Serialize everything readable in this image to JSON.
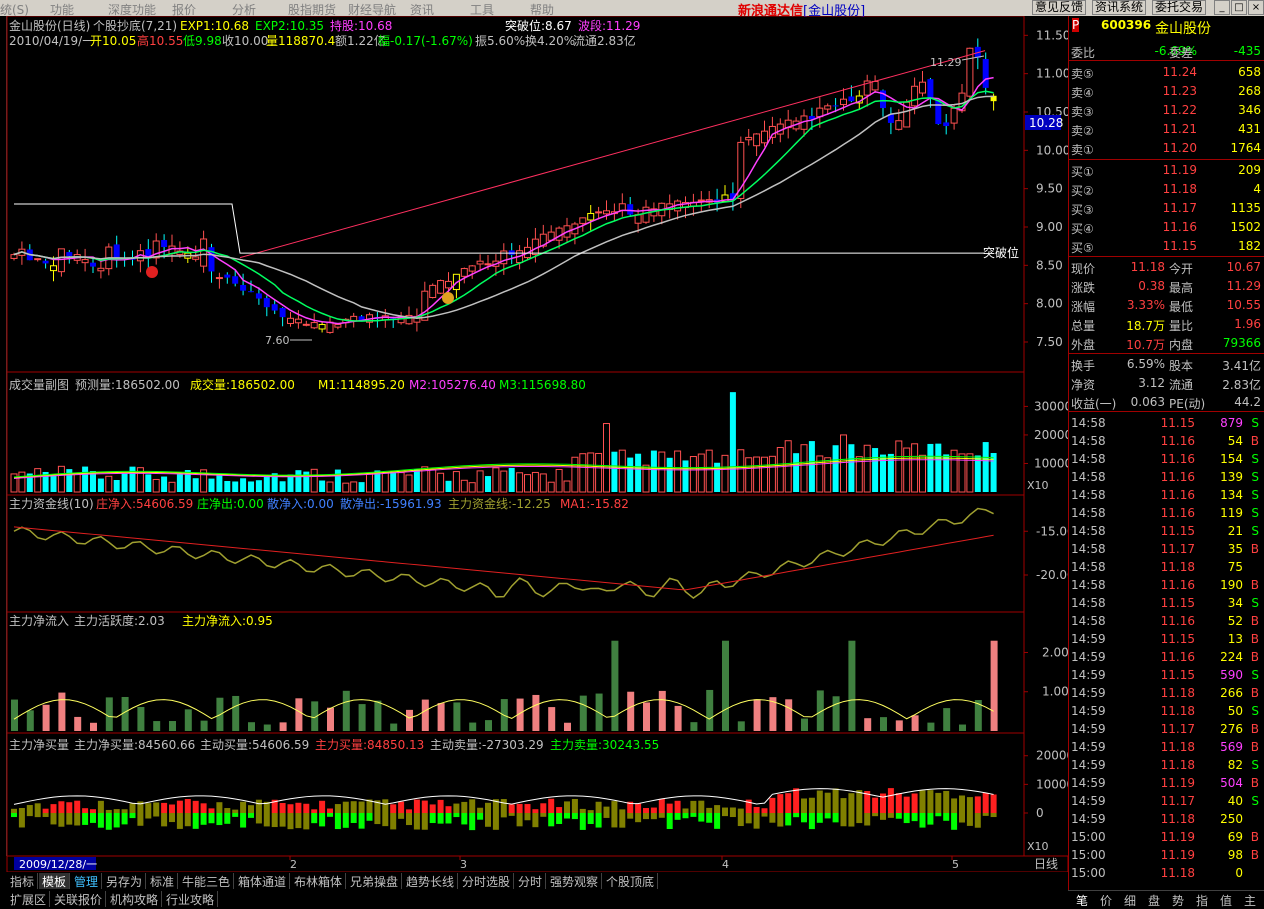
{
  "menu": {
    "items": [
      "统(S)",
      "功能",
      "深度功能",
      "报价",
      "分析",
      "股指期货",
      "财经导航",
      "资讯",
      "工具",
      "帮助"
    ],
    "brand": "新浪通达信",
    "brand_sub": "[金山股份]",
    "buttons": [
      "意见反馈",
      "资讯系统",
      "委托交易"
    ]
  },
  "stock": {
    "code": "600396",
    "name": "金山股份",
    "badge": "P"
  },
  "main_panel": {
    "title": "金山股份(日线)",
    "formula": "个股抄底(7,21)",
    "exp1": "EXP1:10.68",
    "exp2": "EXP2:10.35",
    "hold": "持股:10.68",
    "breakout": "突破位:8.67",
    "wave": "波段:11.29",
    "line2": "2010/04/19/一",
    "open": "开10.05",
    "high": "高10.55",
    "low": "低9.98",
    "close": "收10.00",
    "vol": "量118870.4",
    "amt": "额1.22亿",
    "chg": "幅-0.17(-1.67%)",
    "amp": "振5.60%",
    "turn": "换4.20%",
    "circ": "流通2.83亿",
    "hi_label": "11.29",
    "lo_label": "7.60",
    "breakout_label": "突破位",
    "price_tag": "10.28",
    "yticks": [
      "11.50",
      "11.00",
      "10.50",
      "10.00",
      "9.50",
      "9.00",
      "8.50",
      "8.00",
      "7.50"
    ]
  },
  "vol_panel": {
    "title": "成交量副图",
    "pred": "预测量:186502.00",
    "vol": "成交量:186502.00",
    "m1": "M1:114895.20",
    "m2": "M2:105276.40",
    "m3": "M3:115698.80",
    "yticks": [
      "30000",
      "20000",
      "10000"
    ],
    "unit": "X10"
  },
  "fund_panel": {
    "title": "主力资金线(10)",
    "a": "庄净入:54606.59",
    "b": "庄净出:0.00",
    "c": "散净入:0.00",
    "d": "散净出:-15961.93",
    "e": "主力资金线:-12.25",
    "f": "MA1:-15.82",
    "yticks": [
      "-15.00",
      "-20.00"
    ]
  },
  "flow_panel": {
    "title": "主力净流入",
    "a": "主力活跃度:2.03",
    "b": "主力净流入:0.95",
    "yticks": [
      "2.00",
      "1.00"
    ]
  },
  "buy_panel": {
    "title": "主力净买量",
    "a": "主力净买量:84560.66",
    "b": "主动买量:54606.59",
    "c": "主力买量:84850.13",
    "d": "主动卖量:-27303.29",
    "e": "主力卖量:30243.55",
    "yticks": [
      "20000",
      "10000",
      "0"
    ],
    "unit": "X10"
  },
  "xaxis": {
    "date": "2009/12/28/一",
    "months": [
      "2",
      "3",
      "4",
      "5"
    ],
    "period": "日线"
  },
  "order_book": {
    "weibi_label": "委比",
    "weibi": "-6.69%",
    "weicha_label": "委差",
    "weicha": "-435",
    "asks": [
      {
        "l": "卖⑤",
        "p": "11.24",
        "v": "658"
      },
      {
        "l": "卖④",
        "p": "11.23",
        "v": "268"
      },
      {
        "l": "卖③",
        "p": "11.22",
        "v": "346"
      },
      {
        "l": "卖②",
        "p": "11.21",
        "v": "431"
      },
      {
        "l": "卖①",
        "p": "11.20",
        "v": "1764"
      }
    ],
    "bids": [
      {
        "l": "买①",
        "p": "11.19",
        "v": "209"
      },
      {
        "l": "买②",
        "p": "11.18",
        "v": "4"
      },
      {
        "l": "买③",
        "p": "11.17",
        "v": "1135"
      },
      {
        "l": "买④",
        "p": "11.16",
        "v": "1502"
      },
      {
        "l": "买⑤",
        "p": "11.15",
        "v": "182"
      }
    ]
  },
  "quote": [
    {
      "l1": "现价",
      "v1": "11.18",
      "c1": "#ff4040",
      "l2": "今开",
      "v2": "10.67",
      "c2": "#ff4040"
    },
    {
      "l1": "涨跌",
      "v1": "0.38",
      "c1": "#ff4040",
      "l2": "最高",
      "v2": "11.29",
      "c2": "#ff4040"
    },
    {
      "l1": "涨幅",
      "v1": "3.33%",
      "c1": "#ff4040",
      "l2": "最低",
      "v2": "10.55",
      "c2": "#ff4040"
    },
    {
      "l1": "总量",
      "v1": "18.7万",
      "c1": "#ffff00",
      "l2": "量比",
      "v2": "1.96",
      "c2": "#ff4040"
    },
    {
      "l1": "外盘",
      "v1": "10.7万",
      "c1": "#ff4040",
      "l2": "内盘",
      "v2": "79366",
      "c2": "#00ff00"
    },
    {
      "l1": "换手",
      "v1": "6.59%",
      "c1": "#c0c0c0",
      "l2": "股本",
      "v2": "3.41亿",
      "c2": "#c0c0c0"
    },
    {
      "l1": "净资",
      "v1": "3.12",
      "c1": "#c0c0c0",
      "l2": "流通",
      "v2": "2.83亿",
      "c2": "#c0c0c0"
    },
    {
      "l1": "收益(一)",
      "v1": "0.063",
      "c1": "#c0c0c0",
      "l2": "PE(动)",
      "v2": "44.2",
      "c2": "#c0c0c0"
    }
  ],
  "ticks": [
    {
      "t": "14:58",
      "p": "11.15",
      "v": "879",
      "s": "S"
    },
    {
      "t": "14:58",
      "p": "11.16",
      "v": "54",
      "s": "B"
    },
    {
      "t": "14:58",
      "p": "11.16",
      "v": "154",
      "s": "S"
    },
    {
      "t": "14:58",
      "p": "11.16",
      "v": "139",
      "s": "S"
    },
    {
      "t": "14:58",
      "p": "11.16",
      "v": "134",
      "s": "S"
    },
    {
      "t": "14:58",
      "p": "11.16",
      "v": "119",
      "s": "S"
    },
    {
      "t": "14:58",
      "p": "11.15",
      "v": "21",
      "s": "S"
    },
    {
      "t": "14:58",
      "p": "11.17",
      "v": "35",
      "s": "B"
    },
    {
      "t": "14:58",
      "p": "11.18",
      "v": "75",
      "s": ""
    },
    {
      "t": "14:58",
      "p": "11.16",
      "v": "190",
      "s": "B"
    },
    {
      "t": "14:58",
      "p": "11.15",
      "v": "34",
      "s": "S"
    },
    {
      "t": "14:58",
      "p": "11.16",
      "v": "52",
      "s": "B"
    },
    {
      "t": "14:59",
      "p": "11.15",
      "v": "13",
      "s": "B"
    },
    {
      "t": "14:59",
      "p": "11.16",
      "v": "224",
      "s": "B"
    },
    {
      "t": "14:59",
      "p": "11.15",
      "v": "590",
      "s": "S"
    },
    {
      "t": "14:59",
      "p": "11.18",
      "v": "266",
      "s": "B"
    },
    {
      "t": "14:59",
      "p": "11.18",
      "v": "50",
      "s": "S"
    },
    {
      "t": "14:59",
      "p": "11.17",
      "v": "276",
      "s": "B"
    },
    {
      "t": "14:59",
      "p": "11.18",
      "v": "569",
      "s": "B"
    },
    {
      "t": "14:59",
      "p": "11.18",
      "v": "82",
      "s": "S"
    },
    {
      "t": "14:59",
      "p": "11.19",
      "v": "504",
      "s": "B"
    },
    {
      "t": "14:59",
      "p": "11.17",
      "v": "40",
      "s": "S"
    },
    {
      "t": "14:59",
      "p": "11.18",
      "v": "250",
      "s": ""
    },
    {
      "t": "15:00",
      "p": "11.19",
      "v": "69",
      "s": "B"
    },
    {
      "t": "15:00",
      "p": "11.19",
      "v": "98",
      "s": "B"
    },
    {
      "t": "15:00",
      "p": "11.18",
      "v": "0",
      "s": ""
    }
  ],
  "bottom_tabs": [
    "指标",
    "模板",
    "管理",
    "另存为",
    "标准",
    "牛能三色",
    "箱体通道",
    "布林箱体",
    "兄弟操盘",
    "趋势长线",
    "分时选股",
    "分时",
    "强势观察",
    "个股顶底"
  ],
  "bottom_tabs2": [
    "扩展区",
    "关联报价",
    "机构攻略",
    "行业攻略"
  ],
  "rp_tabs": [
    "笔",
    "价",
    "细",
    "盘",
    "势",
    "指",
    "值",
    "主"
  ]
}
